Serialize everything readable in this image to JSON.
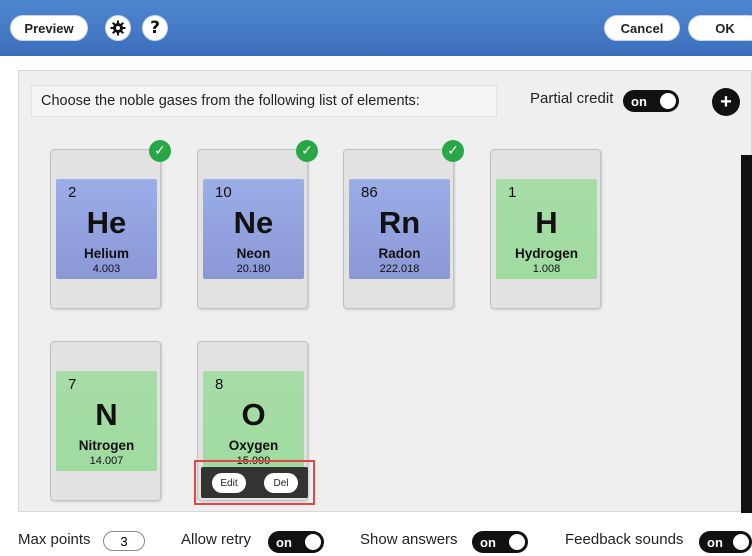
{
  "toolbar": {
    "preview_label": "Preview",
    "settings_icon": "gear-icon",
    "help_label": "?",
    "cancel_label": "Cancel",
    "ok_label": "OK"
  },
  "question": {
    "prompt": "Choose the noble gases from the following list of elements:",
    "partial_credit_label": "Partial credit",
    "partial_credit_state": "on",
    "add_label": "+"
  },
  "elements": [
    {
      "number": "2",
      "symbol": "He",
      "name": "Helium",
      "mass": "4.003",
      "category": "noble-gas",
      "correct": true
    },
    {
      "number": "10",
      "symbol": "Ne",
      "name": "Neon",
      "mass": "20.180",
      "category": "noble-gas",
      "correct": true
    },
    {
      "number": "86",
      "symbol": "Rn",
      "name": "Radon",
      "mass": "222.018",
      "category": "noble-gas",
      "correct": true
    },
    {
      "number": "1",
      "symbol": "H",
      "name": "Hydrogen",
      "mass": "1.008",
      "category": "nonmetal",
      "correct": false
    },
    {
      "number": "7",
      "symbol": "N",
      "name": "Nitrogen",
      "mass": "14.007",
      "category": "nonmetal",
      "correct": false
    },
    {
      "number": "8",
      "symbol": "O",
      "name": "Oxygen",
      "mass": "15.999",
      "category": "nonmetal",
      "correct": false
    }
  ],
  "card_actions": {
    "edit_label": "Edit",
    "delete_label": "Del"
  },
  "footer": {
    "max_points_label": "Max points",
    "max_points_value": "3",
    "allow_retry_label": "Allow retry",
    "allow_retry_state": "on",
    "show_answers_label": "Show answers",
    "show_answers_state": "on",
    "feedback_sounds_label": "Feedback sounds",
    "feedback_sounds_state": "on"
  },
  "colors": {
    "topbar": "#3b6fbd",
    "noble_gas_tile": "#8c97d6",
    "nonmetal_tile": "#a0dba0",
    "correct_check": "#27a844",
    "highlight_border": "#e04848"
  }
}
